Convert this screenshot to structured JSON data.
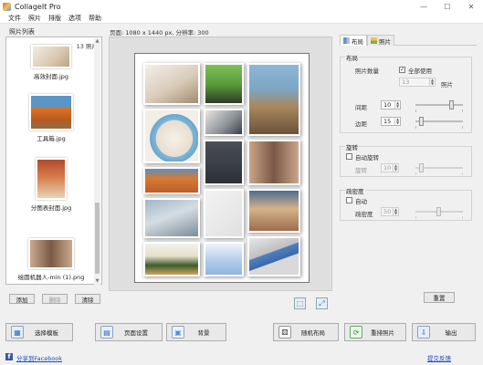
{
  "window": {
    "title": "CollageIt Pro",
    "minimize": "—",
    "maximize": "☐",
    "close": "✕"
  },
  "menu": [
    "文件",
    "照片",
    "排版",
    "选项",
    "帮助"
  ],
  "photo_list": {
    "title": "照片列表",
    "count": "13 照片",
    "items": [
      {
        "name": "高效封面.jpg"
      },
      {
        "name": "工具箱.jpg"
      },
      {
        "name": "分图表封面.jpg"
      },
      {
        "name": "绘圆机器人-min (1).png"
      }
    ],
    "add_label": "添加",
    "remove_label": "删除",
    "clear_label": "清除"
  },
  "page_info": "页面: 1080 x 1440 px, 分辨率: 300",
  "tabs": {
    "layout": "布局",
    "photo": "照片"
  },
  "layout_group": {
    "title": "布局",
    "photo_count_label": "照片数量",
    "use_all_label": "全部使用",
    "use_all_checked": true,
    "photo_count_value": "13",
    "photo_unit": "照片",
    "spacing_label": "间距",
    "spacing_value": "10",
    "spacing_level": 0.75,
    "margin_label": "边距",
    "margin_value": "15",
    "margin_level": 0.1
  },
  "rotation_group": {
    "title": "旋转",
    "auto_label": "自动旋转",
    "rotation_label": "旋转",
    "rotation_value": "10",
    "rotation_level": 0.1
  },
  "density_group": {
    "title": "疏密度",
    "auto_label": "自动",
    "density_label": "疏密度",
    "density_value": "50",
    "density_level": 0.5
  },
  "reset_label": "重置",
  "bottom_buttons": {
    "template": "选择模板",
    "page_setup": "页面设置",
    "background": "背景",
    "random_layout": "随机布局",
    "shuffle": "重排照片",
    "export": "输出"
  },
  "footer": {
    "facebook": "分享到Facebook",
    "feedback": "提交反馈"
  },
  "colors": {
    "accent_blue": "#2a6ab5",
    "link": "#1a4fbf",
    "facebook": "#3b5998"
  }
}
